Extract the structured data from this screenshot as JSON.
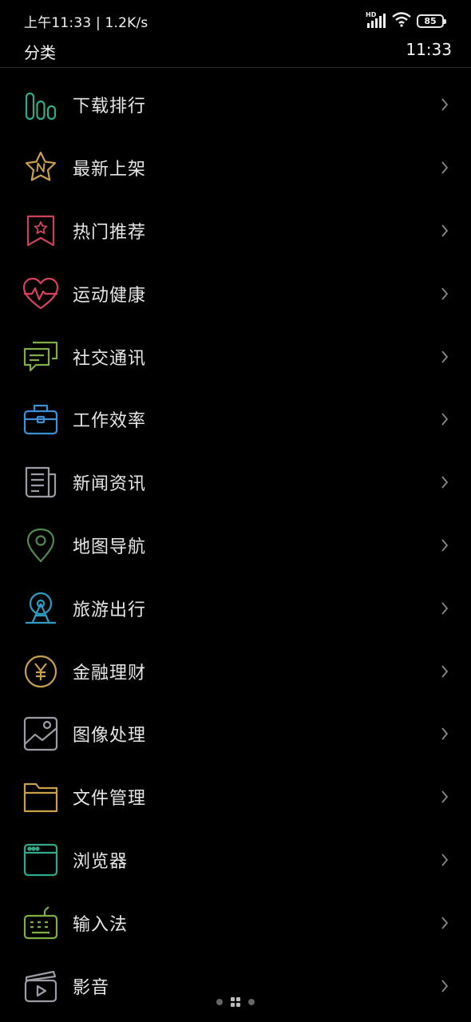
{
  "status_bar": {
    "left_text": "上午11:33 | 1.2K/s",
    "network_label": "HD",
    "battery_level": "85"
  },
  "header": {
    "title": "分类",
    "time": "11:33"
  },
  "categories": [
    {
      "label": "下载排行",
      "icon": "bar-chart-icon",
      "color": "#2fa98a"
    },
    {
      "label": "最新上架",
      "icon": "star-new-icon",
      "color": "#c9a04a"
    },
    {
      "label": "热门推荐",
      "icon": "bookmark-star-icon",
      "color": "#c9445a"
    },
    {
      "label": "运动健康",
      "icon": "heart-pulse-icon",
      "color": "#d8415e"
    },
    {
      "label": "社交通讯",
      "icon": "chat-bubbles-icon",
      "color": "#7fae45"
    },
    {
      "label": "工作效率",
      "icon": "briefcase-icon",
      "color": "#3d8fd6"
    },
    {
      "label": "新闻资讯",
      "icon": "newspaper-icon",
      "color": "#9c9ca6"
    },
    {
      "label": "地图导航",
      "icon": "map-pin-icon",
      "color": "#4f8a4f"
    },
    {
      "label": "旅游出行",
      "icon": "ferris-wheel-icon",
      "color": "#2f9bc4"
    },
    {
      "label": "金融理财",
      "icon": "yuan-coin-icon",
      "color": "#c9a04a"
    },
    {
      "label": "图像处理",
      "icon": "image-icon",
      "color": "#9c9ca6"
    },
    {
      "label": "文件管理",
      "icon": "folder-icon",
      "color": "#c9a04a"
    },
    {
      "label": "浏览器",
      "icon": "browser-window-icon",
      "color": "#2fa98a"
    },
    {
      "label": "输入法",
      "icon": "keyboard-icon",
      "color": "#7fae45"
    },
    {
      "label": "影音",
      "icon": "video-play-icon",
      "color": "#9c9ca6"
    }
  ]
}
